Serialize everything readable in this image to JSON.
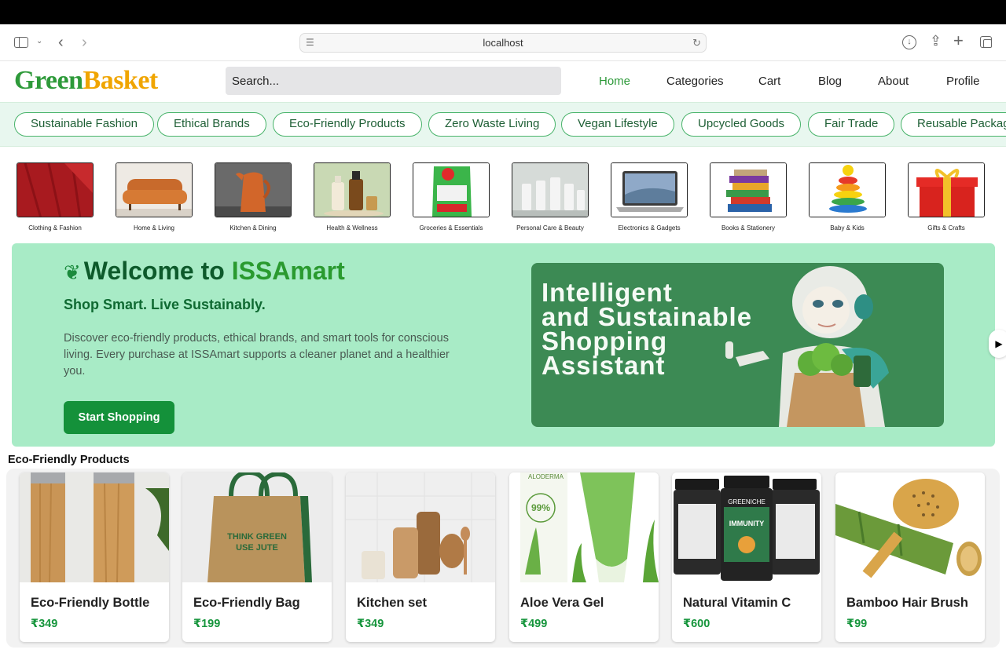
{
  "browser": {
    "url": "localhost"
  },
  "header": {
    "logo_green": "Green",
    "logo_gold": "Basket",
    "search_placeholder": "Search...",
    "nav": [
      "Home",
      "Categories",
      "Cart",
      "Blog",
      "About",
      "Profile"
    ],
    "active_color": "#2e9a3a"
  },
  "chips": [
    "Sustainable Fashion",
    "Ethical Brands",
    "Eco-Friendly Products",
    "Zero Waste Living",
    "Vegan Lifestyle",
    "Upcycled Goods",
    "Fair Trade",
    "Reusable Packagi"
  ],
  "categories": [
    "Clothing & Fashion",
    "Home & Living",
    "Kitchen & Dining",
    "Health & Wellness",
    "Groceries & Essentials",
    "Personal Care & Beauty",
    "Electronics & Gadgets",
    "Books & Stationery",
    "Baby & Kids",
    "Gifts & Crafts"
  ],
  "hero": {
    "title_prefix": "Welcome to ",
    "title_brand": "ISSAmart",
    "subtitle": "Shop Smart. Live Sustainably.",
    "description": "Discover eco-friendly products, ethical brands, and smart tools for conscious living. Every purchase at ISSAmart supports a cleaner planet and a healthier you.",
    "cta": "Start Shopping",
    "banner_lines": [
      "Intelligent",
      "and Sustainable",
      "Shopping",
      "Assistant"
    ],
    "prev_arrow": "◀",
    "next_arrow": "▶"
  },
  "products_section": {
    "title": "Eco-Friendly Products",
    "items": [
      {
        "name": "Eco-Friendly Bottle",
        "price": "₹349"
      },
      {
        "name": "Eco-Friendly Bag",
        "price": "₹199"
      },
      {
        "name": "Kitchen set",
        "price": "₹349"
      },
      {
        "name": "Aloe Vera Gel",
        "price": "₹499"
      },
      {
        "name": "Natural Vitamin C",
        "price": "₹600"
      },
      {
        "name": "Bamboo Hair Brush",
        "price": "₹99"
      }
    ]
  },
  "product_art": {
    "bag_text_1": "THINK GREEN",
    "bag_text_2": "USE JUTE",
    "aloe_brand": "ALODERMA",
    "aloe_pct": "99%",
    "vitc_brand": "GREENICHE",
    "vitc_label": "IMMUNITY"
  }
}
